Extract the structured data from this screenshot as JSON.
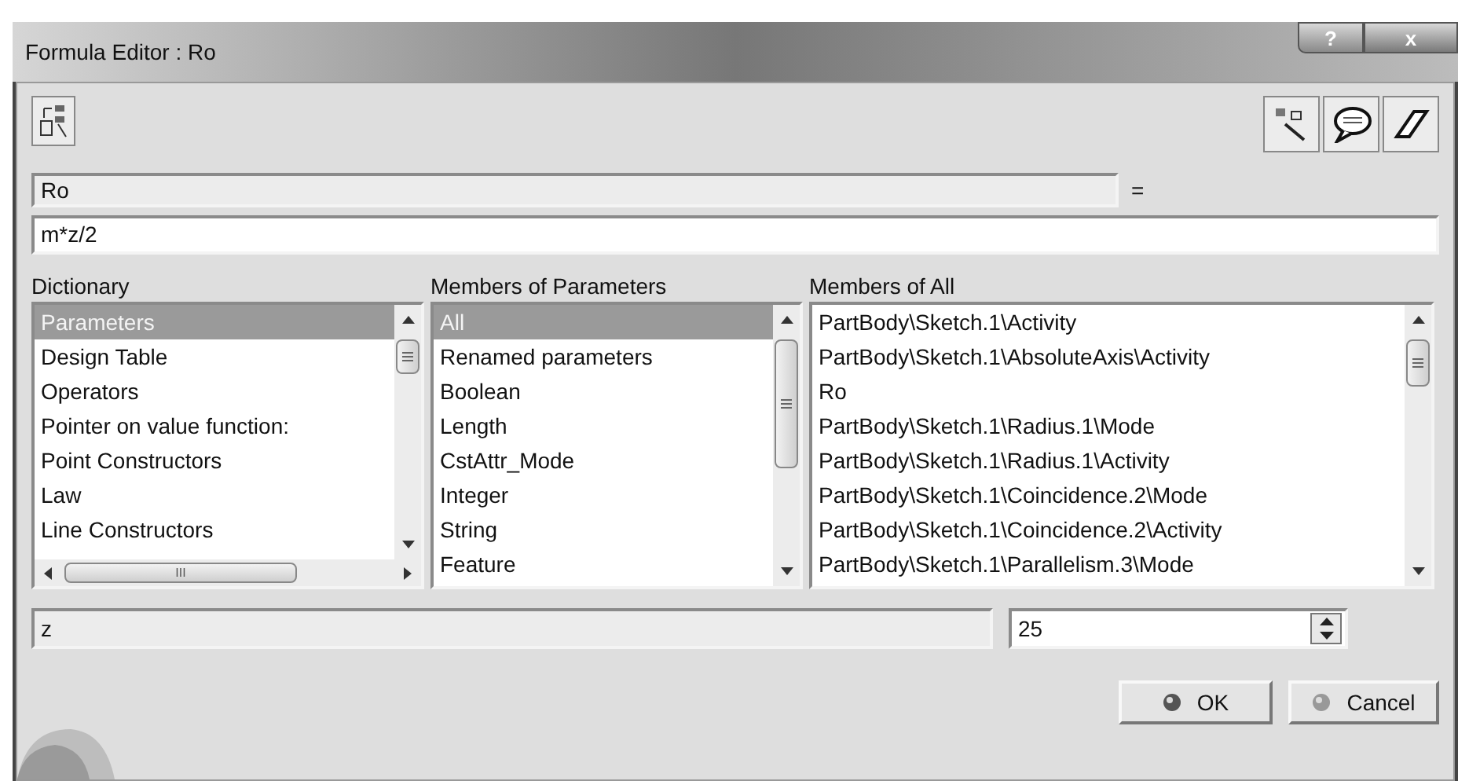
{
  "window": {
    "title": "Formula Editor : Ro",
    "help_button": "?",
    "close_button": "x"
  },
  "parameter_field": {
    "value": "Ro"
  },
  "equals": "=",
  "formula_field": {
    "value": "m*z/2"
  },
  "dictionary": {
    "label": "Dictionary",
    "items": [
      {
        "label": "Parameters",
        "selected": true
      },
      {
        "label": "Design Table",
        "selected": false
      },
      {
        "label": "Operators",
        "selected": false
      },
      {
        "label": "Pointer on value function:",
        "selected": false
      },
      {
        "label": "Point Constructors",
        "selected": false
      },
      {
        "label": "Law",
        "selected": false
      },
      {
        "label": "Line Constructors",
        "selected": false
      }
    ],
    "hscroll_grip": "III"
  },
  "members_of_parameters": {
    "label": "Members of Parameters",
    "items": [
      {
        "label": "All",
        "selected": true
      },
      {
        "label": "Renamed parameters",
        "selected": false
      },
      {
        "label": "Boolean",
        "selected": false
      },
      {
        "label": "Length",
        "selected": false
      },
      {
        "label": "CstAttr_Mode",
        "selected": false
      },
      {
        "label": "Integer",
        "selected": false
      },
      {
        "label": "String",
        "selected": false
      },
      {
        "label": "Feature",
        "selected": false
      }
    ]
  },
  "members_of_all": {
    "label": "Members of All",
    "items": [
      {
        "label": "PartBody\\Sketch.1\\Activity",
        "selected": false
      },
      {
        "label": "PartBody\\Sketch.1\\AbsoluteAxis\\Activity",
        "selected": false
      },
      {
        "label": "Ro",
        "selected": false
      },
      {
        "label": "PartBody\\Sketch.1\\Radius.1\\Mode",
        "selected": false
      },
      {
        "label": "PartBody\\Sketch.1\\Radius.1\\Activity",
        "selected": false
      },
      {
        "label": "PartBody\\Sketch.1\\Coincidence.2\\Mode",
        "selected": false
      },
      {
        "label": "PartBody\\Sketch.1\\Coincidence.2\\Activity",
        "selected": false
      },
      {
        "label": "PartBody\\Sketch.1\\Parallelism.3\\Mode",
        "selected": false
      }
    ]
  },
  "selected_member": {
    "name": "z",
    "value": "25"
  },
  "buttons": [
    {
      "label": "OK"
    },
    {
      "label": "Cancel"
    }
  ]
}
